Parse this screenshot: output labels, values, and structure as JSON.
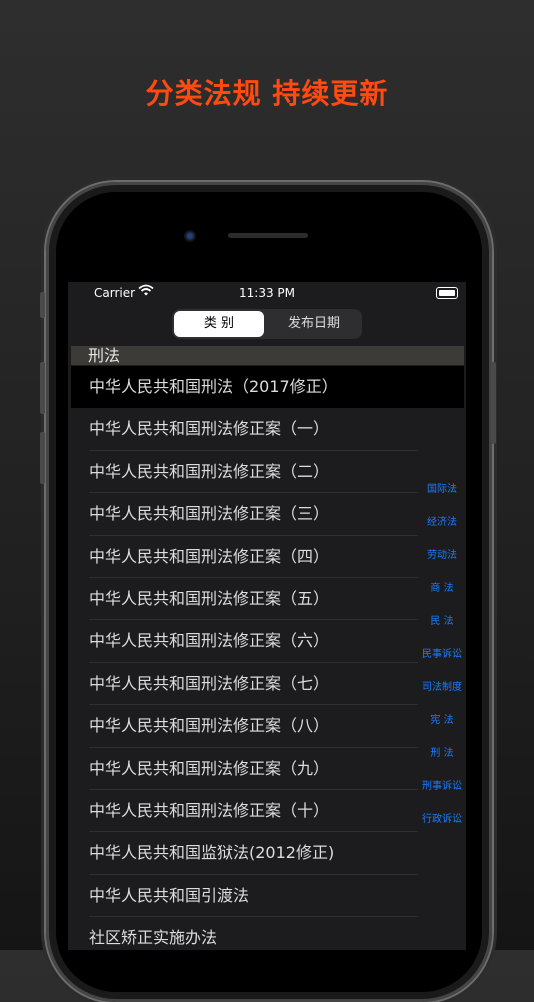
{
  "headline": "分类法规 持续更新",
  "status_bar": {
    "carrier": "Carrier",
    "time": "11:33 PM"
  },
  "segments": {
    "category": "类 别",
    "publish_date": "发布日期"
  },
  "section_header": "刑法",
  "laws": [
    "中华人民共和国刑法（2017修正）",
    "中华人民共和国刑法修正案（一）",
    "中华人民共和国刑法修正案（二）",
    "中华人民共和国刑法修正案（三）",
    "中华人民共和国刑法修正案（四）",
    "中华人民共和国刑法修正案（五）",
    "中华人民共和国刑法修正案（六）",
    "中华人民共和国刑法修正案（七）",
    "中华人民共和国刑法修正案（八）",
    "中华人民共和国刑法修正案（九）",
    "中华人民共和国刑法修正案（十）",
    "中华人民共和国监狱法(2012修正)",
    "中华人民共和国引渡法",
    "社区矫正实施办法"
  ],
  "index_items": [
    "国际法",
    "经济法",
    "劳动法",
    "商 法",
    "民 法",
    "民事诉讼",
    "司法制度",
    "宪 法",
    "刑 法",
    "刑事诉讼",
    "行政诉讼"
  ],
  "colors": {
    "headline": "#ff4a12",
    "index": "#1a7cff"
  }
}
